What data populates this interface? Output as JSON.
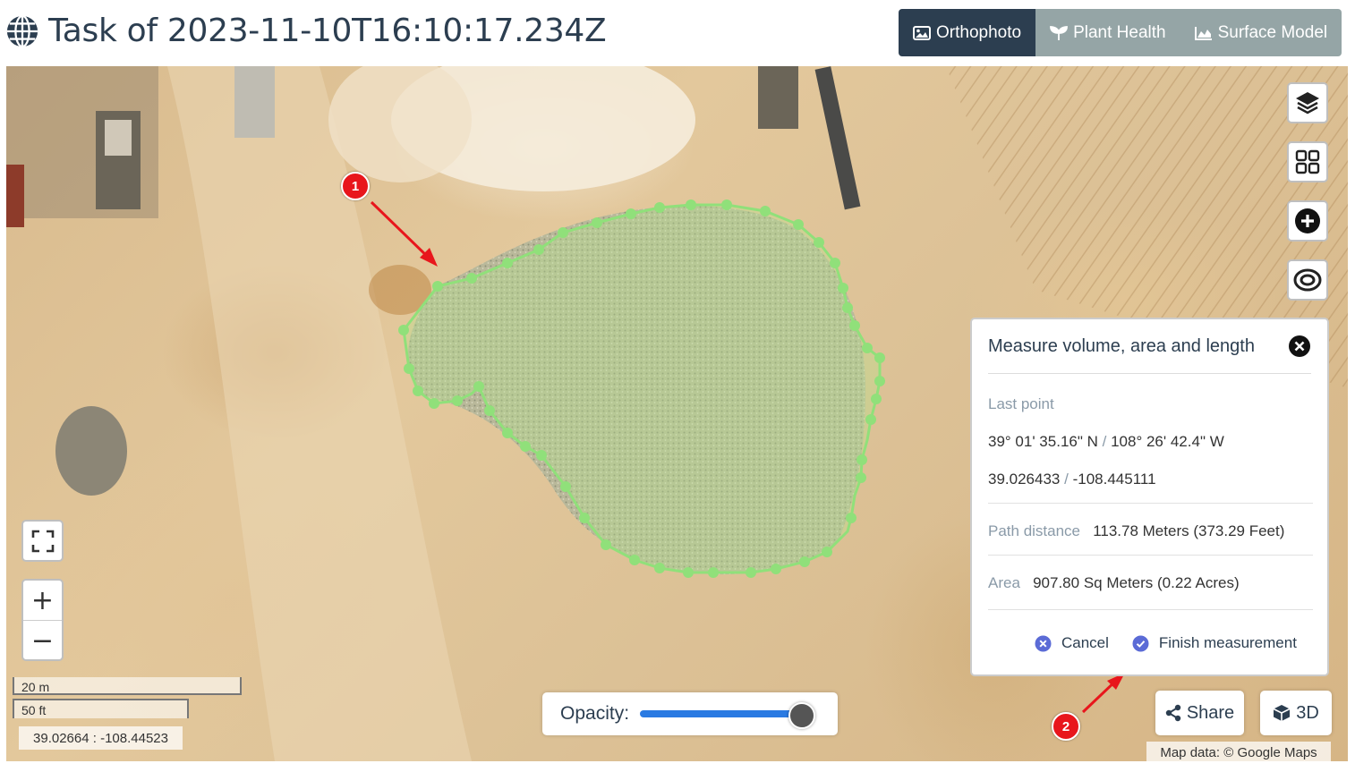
{
  "header": {
    "title": "Task of 2023-11-10T16:10:17.234Z",
    "tabs": [
      {
        "label": "Orthophoto",
        "icon": "image-icon",
        "active": true
      },
      {
        "label": "Plant Health",
        "icon": "leaf-icon",
        "active": false
      },
      {
        "label": "Surface Model",
        "icon": "area-chart-icon",
        "active": false
      }
    ]
  },
  "map": {
    "controls": {
      "right": [
        "layers-icon",
        "grid-icon",
        "plus-circle-icon",
        "eye-ring-icon"
      ],
      "zoom_in": "+",
      "zoom_out": "−"
    },
    "scale": {
      "metric": "20 m",
      "imperial": "50 ft"
    },
    "coords_readout": "39.02664 : -108.44523",
    "opacity": {
      "label": "Opacity:",
      "value": 1.0
    },
    "share_label": "Share",
    "threed_label": "3D",
    "attribution": "Map data: © Google Maps",
    "markers": [
      "1",
      "2"
    ],
    "colors": {
      "measure": "#90e07a",
      "marker": "#e8161c",
      "accent": "#2a7ae2",
      "header_active": "#2c3e50",
      "header_tab": "#95a5a6"
    }
  },
  "panel": {
    "title": "Measure volume, area and length",
    "last_point_label": "Last point",
    "dms_lat": "39° 01' 35.16\" N",
    "dms_sep": "/",
    "dms_lon": "108° 26' 42.4\" W",
    "dec_lat": "39.026433",
    "dec_sep": "/",
    "dec_lon": "-108.445111",
    "distance_label": "Path distance",
    "distance_value": "113.78 Meters (373.29 Feet)",
    "area_label": "Area",
    "area_value": "907.80 Sq Meters (0.22 Acres)",
    "cancel_label": "Cancel",
    "finish_label": "Finish measurement"
  }
}
